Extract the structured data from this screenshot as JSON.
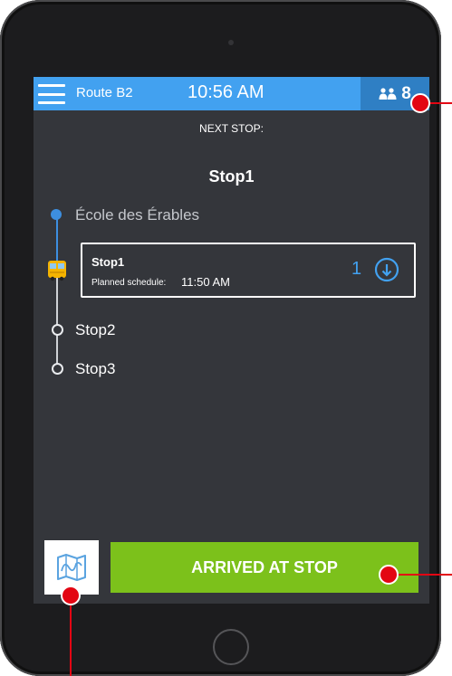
{
  "header": {
    "route": "Route B2",
    "time": "10:56 AM",
    "passenger_count": "8"
  },
  "next_stop": {
    "label": "NEXT STOP:",
    "name": "Stop1"
  },
  "timeline": {
    "past_stop": "École des Érables",
    "current": {
      "name": "Stop1",
      "schedule_label": "Planned schedule:",
      "schedule_time": "11:50 AM",
      "dropoff_count": "1"
    },
    "upcoming": [
      "Stop2",
      "Stop3"
    ]
  },
  "actions": {
    "arrived_label": "ARRIVED AT STOP"
  },
  "icons": {
    "menu": "hamburger-menu-icon",
    "passengers": "people-icon",
    "bus": "bus-icon",
    "dropoff": "arrow-down-circle-icon",
    "map": "map-icon"
  },
  "colors": {
    "header": "#42a1f0",
    "passenger_badge": "#2f7fc4",
    "screen_bg": "#34363b",
    "completed": "#3d8fe0",
    "arrived_button": "#7cc11b",
    "callout": "#e30613"
  }
}
